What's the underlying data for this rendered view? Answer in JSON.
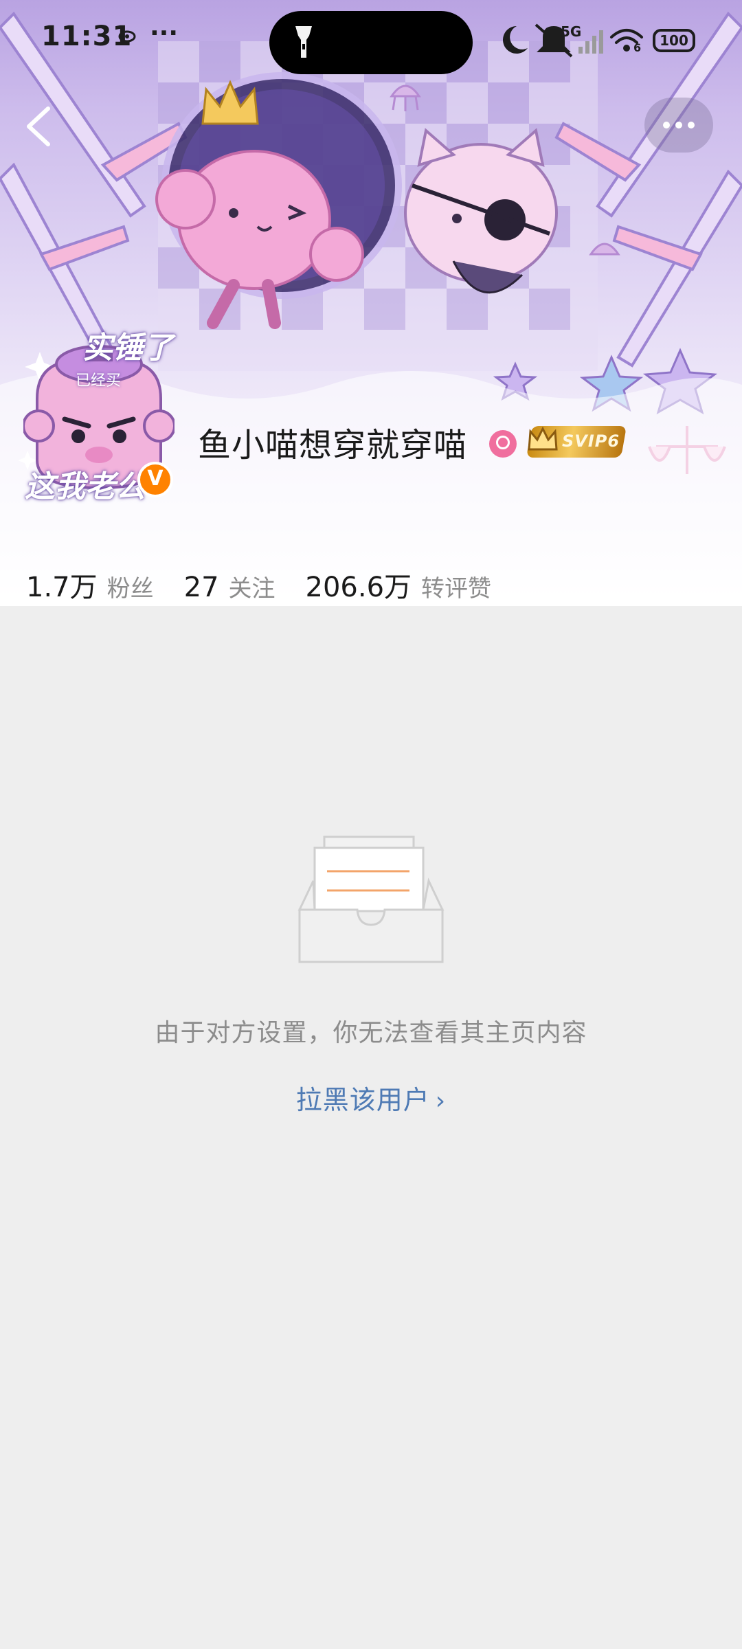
{
  "status_bar": {
    "time": "11:31",
    "dots": "···",
    "network": "5G",
    "wifi_level": "6",
    "battery": "100"
  },
  "nav": {
    "back_icon": "chevron-left-icon",
    "more_icon": "more-horizontal-icon"
  },
  "profile": {
    "avatar_text_top": "实锤了",
    "avatar_text_mid": "已经买",
    "avatar_text_bottom": "这我老公",
    "verified_badge": "V",
    "username": "鱼小喵想穿就穿喵",
    "gender_icon": "female-icon",
    "svip_label": "SVIP6",
    "colors": {
      "verified": "#ff8200",
      "gender": "#f06e9e",
      "svip": "#e0a83a"
    }
  },
  "stats": [
    {
      "value": "1.7万",
      "label": "粉丝"
    },
    {
      "value": "27",
      "label": "关注"
    },
    {
      "value": "206.6万",
      "label": "转评赞"
    }
  ],
  "empty_state": {
    "icon": "empty-inbox-icon",
    "message": "由于对方设置，你无法查看其主页内容",
    "block_link": "拉黑该用户",
    "link_color": "#4e7ab4"
  }
}
